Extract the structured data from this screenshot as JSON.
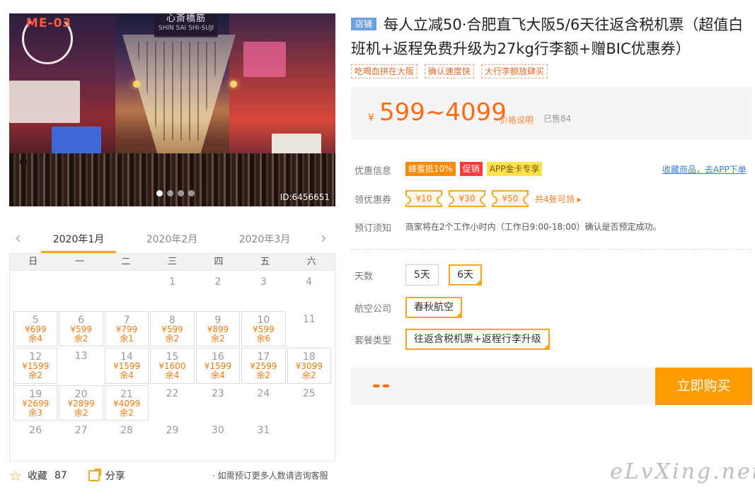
{
  "photo": {
    "sign_top": "心斎橋筋",
    "sign_sub": "SHIN SAI SHI-SUJI",
    "logo": "ME-03",
    "id_label": "ID:6456651"
  },
  "calendar": {
    "months": [
      "2020年1月",
      "2020年2月",
      "2020年3月"
    ],
    "active_month": 0,
    "weekdays": [
      "日",
      "一",
      "二",
      "三",
      "四",
      "五",
      "六"
    ],
    "prev_icon": "chevron-left-icon",
    "next_icon": "chevron-right-icon",
    "lead_blanks": 3,
    "days": [
      {
        "d": "1"
      },
      {
        "d": "2"
      },
      {
        "d": "3"
      },
      {
        "d": "4"
      },
      {
        "d": "5",
        "p": "¥699",
        "s": "余4"
      },
      {
        "d": "6",
        "p": "¥599",
        "s": "余2"
      },
      {
        "d": "7",
        "p": "¥799",
        "s": "余1"
      },
      {
        "d": "8",
        "p": "¥599",
        "s": "余2"
      },
      {
        "d": "9",
        "p": "¥899",
        "s": "余2"
      },
      {
        "d": "10",
        "p": "¥599",
        "s": "余6"
      },
      {
        "d": "11"
      },
      {
        "d": "12",
        "p": "¥1599",
        "s": "余2"
      },
      {
        "d": "13"
      },
      {
        "d": "14",
        "p": "¥1599",
        "s": "余4"
      },
      {
        "d": "15",
        "p": "¥1600",
        "s": "余4"
      },
      {
        "d": "16",
        "p": "¥1599",
        "s": "余4"
      },
      {
        "d": "17",
        "p": "¥2599",
        "s": "余2"
      },
      {
        "d": "18",
        "p": "¥3099",
        "s": "余2"
      },
      {
        "d": "19",
        "p": "¥2699",
        "s": "余3"
      },
      {
        "d": "20",
        "p": "¥2899",
        "s": "余2"
      },
      {
        "d": "21",
        "p": "¥4099",
        "s": "余2"
      },
      {
        "d": "22"
      },
      {
        "d": "23"
      },
      {
        "d": "24"
      },
      {
        "d": "25"
      },
      {
        "d": "26"
      },
      {
        "d": "27"
      },
      {
        "d": "28"
      },
      {
        "d": "29"
      },
      {
        "d": "30"
      },
      {
        "d": "31"
      }
    ]
  },
  "footer": {
    "fav_label": "收藏",
    "fav_count": "87",
    "share_label": "分享",
    "consult": "· 如需预订更多人数请咨询客服"
  },
  "product": {
    "shop_tag": "店铺",
    "title": "每人立减50·合肥直飞大阪5/6天往返含税机票（超值白班机+返程免费升级为27kg行李额+赠BIC优惠券）",
    "tags": [
      "吃喝血拼在大阪",
      "确认速度快",
      "大行李额放肆买"
    ],
    "currency": "¥",
    "price": "599~4099",
    "price_explain": "价格说明",
    "sold": "已售84"
  },
  "promo": {
    "label": "优惠信息",
    "badges": [
      "蜂蜜抵10%",
      "促销",
      "APP金卡专享"
    ],
    "fav_link": "收藏商品，去APP下单"
  },
  "coupon": {
    "label": "领优惠券",
    "items": [
      "¥10",
      "¥30",
      "¥50"
    ],
    "more": "共4张可领 ▸"
  },
  "notice": {
    "label": "预订须知",
    "text": "商家将在2个工作小时内（工作日9:00-18:00）确认是否预定成功。"
  },
  "options": {
    "days_label": "天数",
    "days": [
      "5天",
      "6天"
    ],
    "days_selected": 1,
    "airline_label": "航空公司",
    "airline": "春秋航空",
    "package_label": "套餐类型",
    "package": "往返含税机票+返程行李升级"
  },
  "buy": {
    "total": "--",
    "button": "立即购买"
  },
  "watermark": "eLvXing.net",
  "colors": {
    "accent": "#ff9c00",
    "price": "#ff6a10",
    "link": "#3a7ad8",
    "shop_tag": "#6ea0e0"
  }
}
